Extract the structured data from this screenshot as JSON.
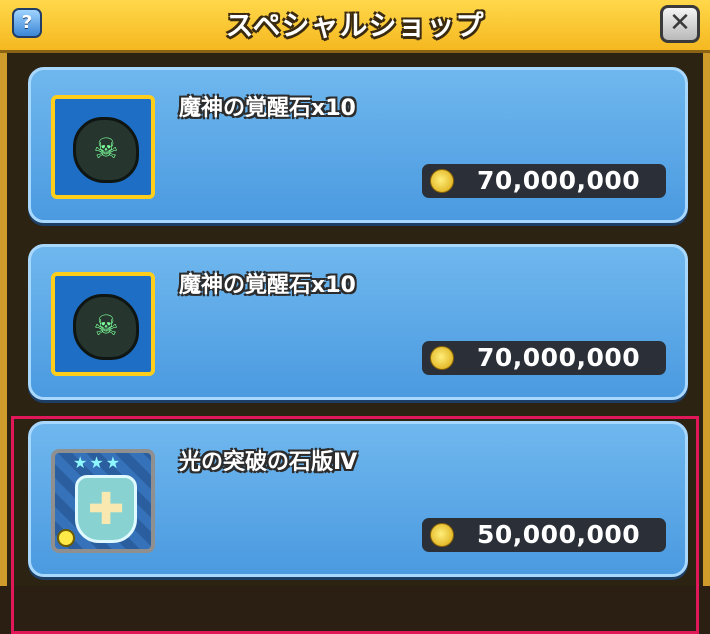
{
  "header": {
    "title": "スペシャルショップ",
    "help_label": "?",
    "close_label": "✕"
  },
  "items": [
    {
      "name": "魔神の覚醒石x10",
      "price": "70,000,000",
      "icon": "awakening-stone-icon",
      "highlighted": false
    },
    {
      "name": "魔神の覚醒石x10",
      "price": "70,000,000",
      "icon": "awakening-stone-icon",
      "highlighted": false
    },
    {
      "name": "光の突破の石版Ⅳ",
      "price": "50,000,000",
      "icon": "breakthrough-tablet-icon",
      "highlighted": true
    }
  ],
  "colors": {
    "header_bg": "#ffd84a",
    "panel_bg": "#4b9ae0",
    "highlight": "#e0185a",
    "price_bg": "#2a2f38"
  }
}
